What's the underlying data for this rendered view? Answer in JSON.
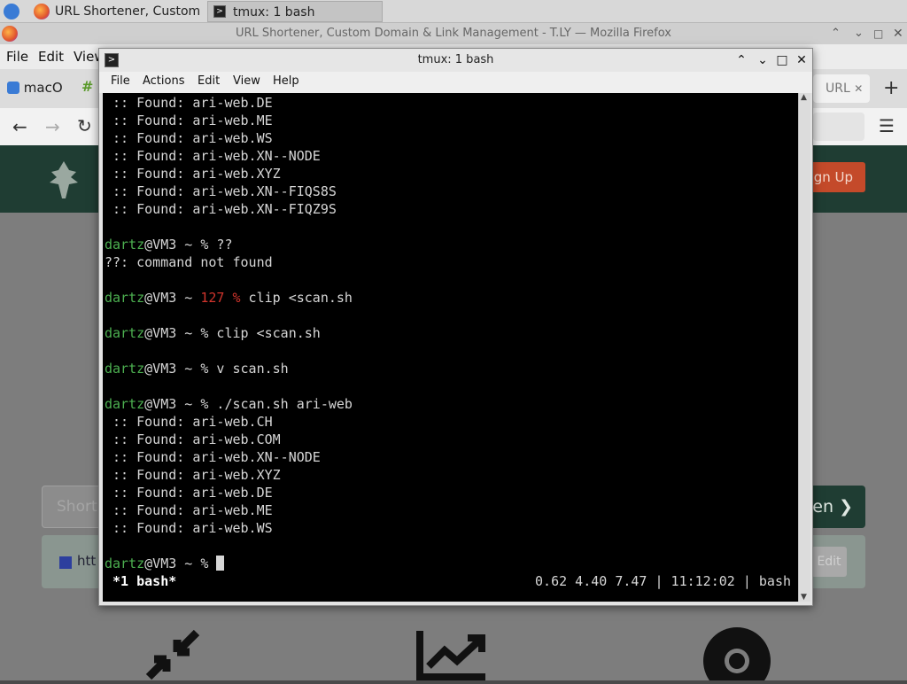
{
  "taskbar": {
    "tasks": [
      {
        "label": "URL Shortener, Custom ..."
      },
      {
        "label": "tmux: 1 bash"
      }
    ]
  },
  "firefox": {
    "window_title": "URL Shortener, Custom Domain & Link Management - T.LY — Mozilla Firefox",
    "menu": [
      "File",
      "Edit",
      "View"
    ],
    "tab_left_label": "macO",
    "tab_right_label": "URL",
    "signup_label": "ign Up",
    "shorten_placeholder": "Short",
    "shorten_button_label": "en",
    "link_prefix": "htt",
    "edit_label": "Edit"
  },
  "terminal": {
    "title": "tmux: 1 bash",
    "menu": [
      "File",
      "Actions",
      "Edit",
      "View",
      "Help"
    ],
    "prompt_user": "dartz",
    "prompt_host": "@VM3 ~ ",
    "lines": [
      {
        "text": " :: Found: ari-web.DE"
      },
      {
        "text": " :: Found: ari-web.ME"
      },
      {
        "text": " :: Found: ari-web.WS"
      },
      {
        "text": " :: Found: ari-web.XN--NODE"
      },
      {
        "text": " :: Found: ari-web.XYZ"
      },
      {
        "text": " :: Found: ari-web.XN--FIQS8S"
      },
      {
        "text": " :: Found: ari-web.XN--FIQZ9S"
      },
      {
        "text": ""
      },
      {
        "prompt": true,
        "code": "",
        "cmd": "% ??"
      },
      {
        "text": "??: command not found"
      },
      {
        "text": ""
      },
      {
        "prompt": true,
        "code": "127 %",
        "cmd": " clip <scan.sh"
      },
      {
        "text": ""
      },
      {
        "prompt": true,
        "code": "",
        "cmd": "% clip <scan.sh"
      },
      {
        "text": ""
      },
      {
        "prompt": true,
        "code": "",
        "cmd": "% v scan.sh"
      },
      {
        "text": ""
      },
      {
        "prompt": true,
        "code": "",
        "cmd": "% ./scan.sh ari-web"
      },
      {
        "text": " :: Found: ari-web.CH"
      },
      {
        "text": " :: Found: ari-web.COM"
      },
      {
        "text": " :: Found: ari-web.XN--NODE"
      },
      {
        "text": " :: Found: ari-web.XYZ"
      },
      {
        "text": " :: Found: ari-web.DE"
      },
      {
        "text": " :: Found: ari-web.ME"
      },
      {
        "text": " :: Found: ari-web.WS"
      },
      {
        "text": ""
      },
      {
        "prompt": true,
        "code": "",
        "cmd": "% ",
        "cursor": true
      }
    ],
    "status_left": " *1 bash*",
    "status_right": "0.62 4.40 7.47 | 11:12:02 | bash"
  },
  "colors": {
    "prompt_green": "#4caf50",
    "error_red": "#d0342c",
    "site_green": "#1f3d33",
    "signup_orange": "#c44a2a"
  }
}
